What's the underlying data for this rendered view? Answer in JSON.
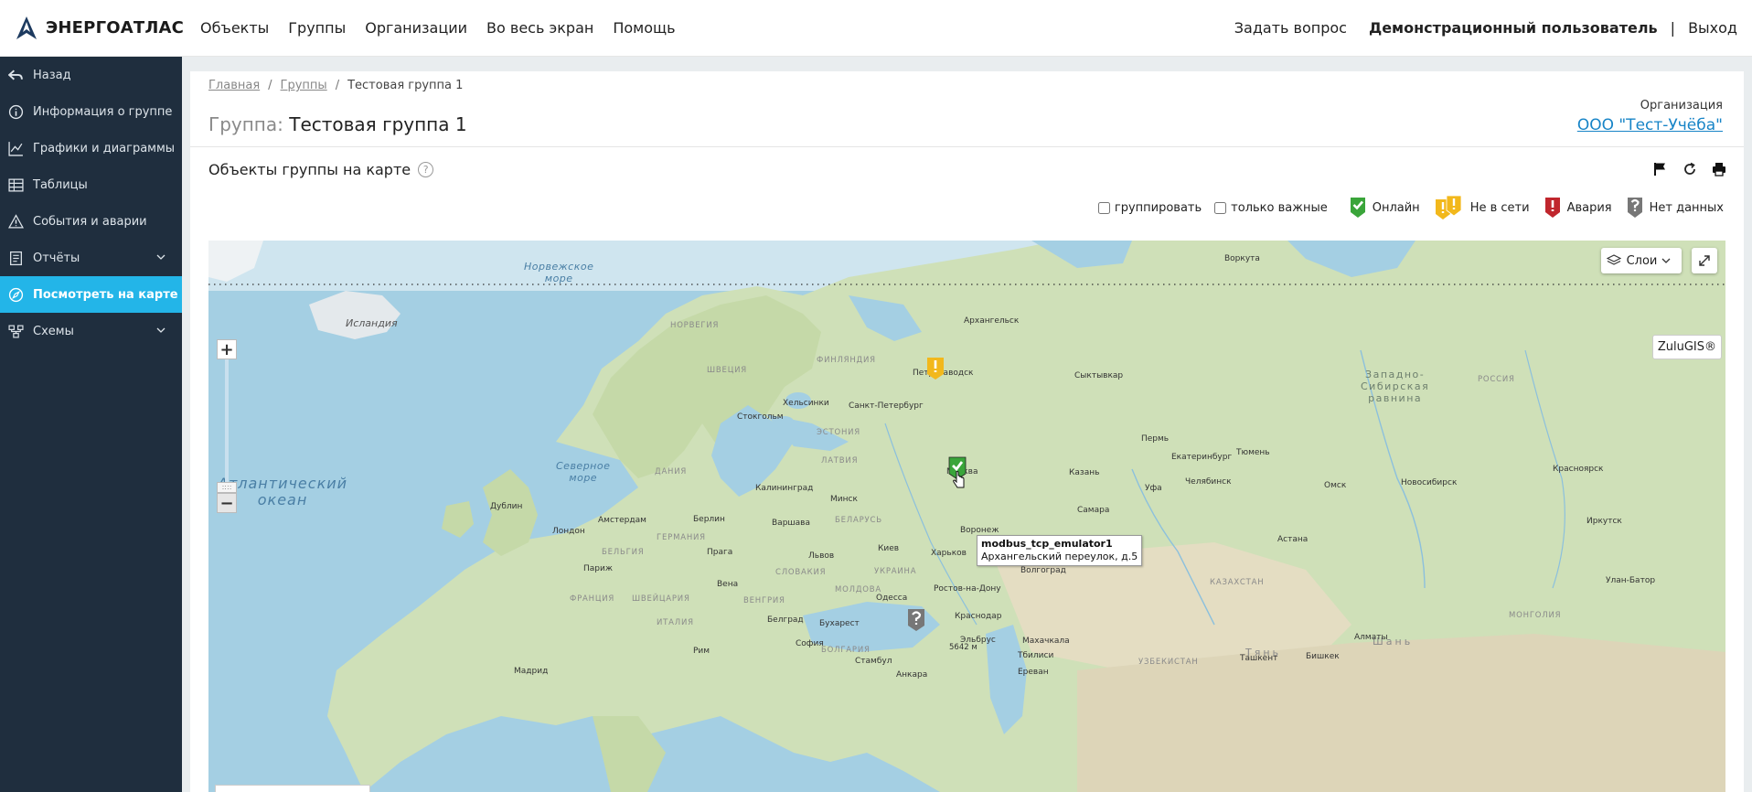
{
  "brand": {
    "name": "ЭНЕРГОАТЛАС"
  },
  "topnav": [
    "Объекты",
    "Группы",
    "Организации",
    "Во весь экран",
    "Помощь"
  ],
  "topright": {
    "ask": "Задать вопрос",
    "user": "Демонстрационный пользователь",
    "sep": "|",
    "logout": "Выход"
  },
  "sidebar": {
    "items": [
      {
        "label": "Назад",
        "icon": "back-arrow-icon"
      },
      {
        "label": "Информация о группе",
        "icon": "info-icon"
      },
      {
        "label": "Графики и диаграммы",
        "icon": "chart-line-icon"
      },
      {
        "label": "Таблицы",
        "icon": "table-icon"
      },
      {
        "label": "События и аварии",
        "icon": "warning-icon"
      },
      {
        "label": "Отчёты",
        "icon": "report-icon"
      },
      {
        "label": "Посмотреть на карте",
        "icon": "map-icon"
      },
      {
        "label": "Схемы",
        "icon": "schema-icon"
      }
    ],
    "active": "Посмотреть на карте"
  },
  "breadcrumb": {
    "home": "Главная",
    "groups": "Группы",
    "current": "Тестовая группа 1"
  },
  "group": {
    "prefix": "Группа:",
    "name": "Тестовая группа 1"
  },
  "org": {
    "label": "Организация",
    "name": "ООО \"Тест-Учёба\""
  },
  "section": {
    "title": "Объекты группы на карте",
    "help": "?"
  },
  "filters": {
    "group": "группировать",
    "important": "только важные"
  },
  "legend": [
    {
      "label": "Онлайн",
      "color": "#3aa53a"
    },
    {
      "label": "Не в сети",
      "color": "#f2b81c"
    },
    {
      "label": "Авария",
      "color": "#c0262d"
    },
    {
      "label": "Нет данных",
      "color": "#777777"
    }
  ],
  "map": {
    "layers_label": "Слои",
    "zulu_label": "ZuluGIS®",
    "tooltip": {
      "name": "modbus_tcp_emulator1",
      "address": "Архангельский переулок, д.5"
    },
    "seas": {
      "norwegian": "Норвежское\nморе",
      "north": "Северное\nморе",
      "atlantic": "Атлантический\nокеан"
    },
    "regions": {
      "west_siberian": "Западно-\nСибирская\nравнина"
    },
    "countries": [
      "НОРВЕГИЯ",
      "ФИНЛЯНДИЯ",
      "ШВЕЦИЯ",
      "ЭСТОНИЯ",
      "ЛАТВИЯ",
      "ДАНИЯ",
      "БЕЛАРУСЬ",
      "ГЕРМАНИЯ",
      "БЕЛЬГИЯ",
      "ФРАНЦИЯ",
      "ШВЕЙЦАРИЯ",
      "ИТАЛИЯ",
      "СЛОВАКИЯ",
      "ВЕНГРИЯ",
      "УКРАИНА",
      "МОЛДОВА",
      "БОЛГАРИЯ",
      "КАЗАХСТАН",
      "УЗБЕКИСТАН",
      "РОССИЯ",
      "МОНГОЛИЯ",
      "Шань",
      "Тянь"
    ],
    "cities": [
      "Воркута",
      "Архангельск",
      "Петрозаводск",
      "Сыктывкар",
      "Хельсинки",
      "Санкт-Петербург",
      "Стокгольм",
      "Пермь",
      "Екатеринбург",
      "Тюмень",
      "Москва",
      "Казань",
      "Калининград",
      "Минск",
      "Уфа",
      "Челябинск",
      "Омск",
      "Новосибирск",
      "Красноярск",
      "Дублин",
      "Лондон",
      "Амстердам",
      "Берлин",
      "Варшава",
      "Самара",
      "Воронеж",
      "Иркутск",
      "Прага",
      "Париж",
      "Киев",
      "Харьков",
      "Львов",
      "Вена",
      "Волгоград",
      "Астана",
      "Улан-Батор",
      "Одесса",
      "Ростов-на-Дону",
      "Белград",
      "Бухарест",
      "Краснодар",
      "Эльбрус",
      "5642 м",
      "Махачкала",
      "Алматы",
      "Рим",
      "София",
      "Стамбул",
      "Тбилиси",
      "Мадрид",
      "Анкара",
      "Ереван",
      "Ташкент",
      "Бишкек",
      "Исландия"
    ]
  }
}
